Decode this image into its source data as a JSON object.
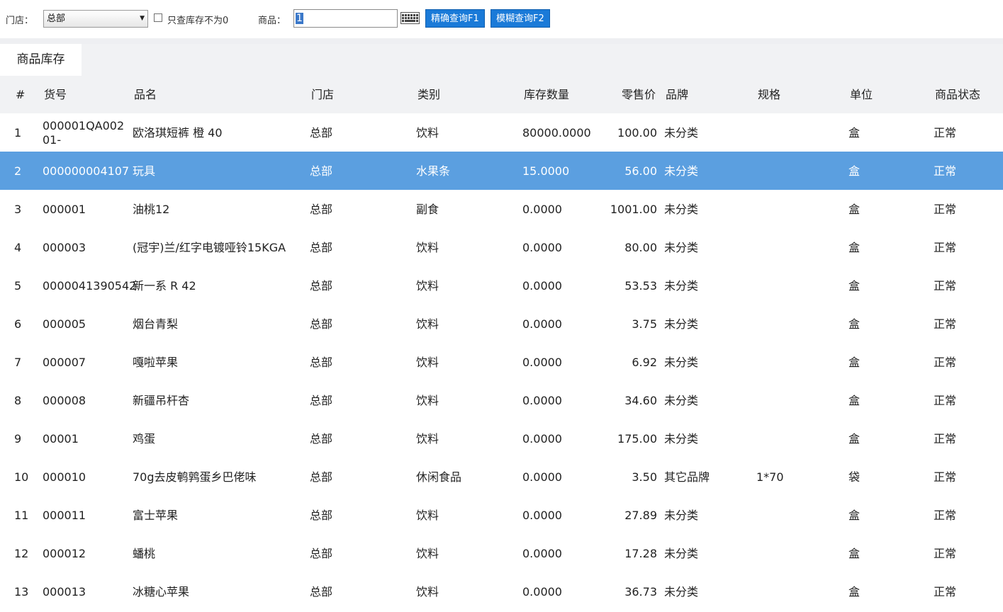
{
  "toolbar": {
    "store_label": "门店：",
    "store_value": "总部",
    "only_nonzero_label": "只查库存不为0",
    "goods_label": "商品：",
    "goods_value": "1",
    "exact_query": "精确查询F1",
    "fuzzy_query": "模糊查询F2"
  },
  "tab": {
    "label": "商品库存"
  },
  "table": {
    "headers": [
      "#",
      "货号",
      "品名",
      "门店",
      "类别",
      "库存数量",
      "零售价",
      "品牌",
      "规格",
      "单位",
      "商品状态"
    ],
    "selected_row": 2,
    "rows": [
      {
        "idx": "1",
        "code": "000001QA00201-",
        "name": "欧洛琪短裤 橙 40",
        "store": "总部",
        "cat": "饮料",
        "qty": "80000.0000",
        "price": "100.00",
        "brand": "未分类",
        "spec": "",
        "unit": "盒",
        "status": "正常"
      },
      {
        "idx": "2",
        "code": "000000004107",
        "name": "玩具",
        "store": "总部",
        "cat": "水果条",
        "qty": "15.0000",
        "price": "56.00",
        "brand": "未分类",
        "spec": "",
        "unit": "盒",
        "status": "正常"
      },
      {
        "idx": "3",
        "code": "000001",
        "name": "油桃12",
        "store": "总部",
        "cat": "副食",
        "qty": "0.0000",
        "price": "1001.00",
        "brand": "未分类",
        "spec": "",
        "unit": "盒",
        "status": "正常"
      },
      {
        "idx": "4",
        "code": "000003",
        "name": "(冠宇)兰/红字电镀哑铃15KGA",
        "store": "总部",
        "cat": "饮料",
        "qty": "0.0000",
        "price": "80.00",
        "brand": "未分类",
        "spec": "",
        "unit": "盒",
        "status": "正常"
      },
      {
        "idx": "5",
        "code": "0000041390542",
        "name": "新一系 R 42",
        "store": "总部",
        "cat": "饮料",
        "qty": "0.0000",
        "price": "53.53",
        "brand": "未分类",
        "spec": "",
        "unit": "盒",
        "status": "正常"
      },
      {
        "idx": "6",
        "code": "000005",
        "name": "烟台青梨",
        "store": "总部",
        "cat": "饮料",
        "qty": "0.0000",
        "price": "3.75",
        "brand": "未分类",
        "spec": "",
        "unit": "盒",
        "status": "正常"
      },
      {
        "idx": "7",
        "code": "000007",
        "name": "嘎啦苹果",
        "store": "总部",
        "cat": "饮料",
        "qty": "0.0000",
        "price": "6.92",
        "brand": "未分类",
        "spec": "",
        "unit": "盒",
        "status": "正常"
      },
      {
        "idx": "8",
        "code": "000008",
        "name": "新疆吊杆杏",
        "store": "总部",
        "cat": "饮料",
        "qty": "0.0000",
        "price": "34.60",
        "brand": "未分类",
        "spec": "",
        "unit": "盒",
        "status": "正常"
      },
      {
        "idx": "9",
        "code": "00001",
        "name": "鸡蛋",
        "store": "总部",
        "cat": "饮料",
        "qty": "0.0000",
        "price": "175.00",
        "brand": "未分类",
        "spec": "",
        "unit": "盒",
        "status": "正常"
      },
      {
        "idx": "10",
        "code": "000010",
        "name": "70g去皮鹌鹑蛋乡巴佬味",
        "store": "总部",
        "cat": "休闲食品",
        "qty": "0.0000",
        "price": "3.50",
        "brand": "其它品牌",
        "spec": "1*70",
        "unit": "袋",
        "status": "正常"
      },
      {
        "idx": "11",
        "code": "000011",
        "name": "富士苹果",
        "store": "总部",
        "cat": "饮料",
        "qty": "0.0000",
        "price": "27.89",
        "brand": "未分类",
        "spec": "",
        "unit": "盒",
        "status": "正常"
      },
      {
        "idx": "12",
        "code": "000012",
        "name": "蟠桃",
        "store": "总部",
        "cat": "饮料",
        "qty": "0.0000",
        "price": "17.28",
        "brand": "未分类",
        "spec": "",
        "unit": "盒",
        "status": "正常"
      },
      {
        "idx": "13",
        "code": "000013",
        "name": "冰糖心苹果",
        "store": "总部",
        "cat": "饮料",
        "qty": "0.0000",
        "price": "36.73",
        "brand": "未分类",
        "spec": "",
        "unit": "盒",
        "status": "正常"
      }
    ]
  },
  "colors": {
    "accent": "#1a7ad8",
    "selected_row": "#5b9fe0",
    "header_bg": "#f1f2f4"
  },
  "icons": {
    "keyboard": "keyboard-icon",
    "dropdown": "chevron-down-icon"
  }
}
